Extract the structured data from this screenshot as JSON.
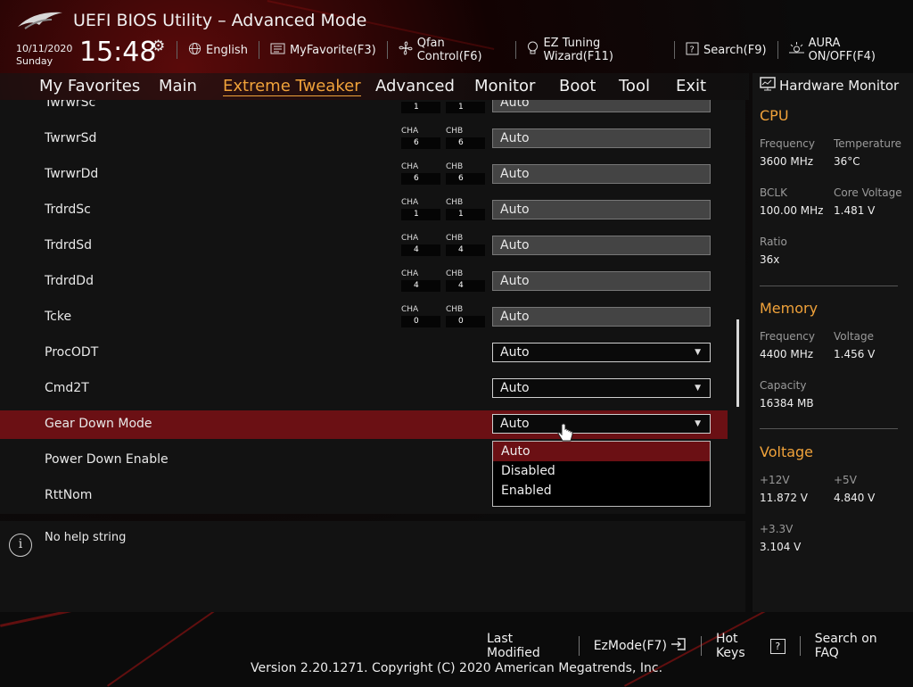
{
  "header": {
    "title": "UEFI BIOS Utility – Advanced Mode",
    "date": "10/11/2020",
    "day": "Sunday",
    "time": "15:48",
    "toolbar": [
      {
        "label": "English",
        "icon": "globe-icon"
      },
      {
        "label": "MyFavorite(F3)",
        "icon": "favorite-icon"
      },
      {
        "label": "Qfan Control(F6)",
        "icon": "fan-icon"
      },
      {
        "label": "EZ Tuning Wizard(F11)",
        "icon": "bulb-icon"
      },
      {
        "label": "Search(F9)",
        "icon": "help-search-icon"
      },
      {
        "label": "AURA ON/OFF(F4)",
        "icon": "aura-icon"
      }
    ]
  },
  "nav": {
    "tabs": [
      "My Favorites",
      "Main",
      "Extreme Tweaker",
      "Advanced",
      "Monitor",
      "Boot",
      "Tool",
      "Exit"
    ],
    "active": "Extreme Tweaker"
  },
  "settings": {
    "cha_label": "CHA",
    "chb_label": "CHB",
    "rows": [
      {
        "label": "TwrwrSc",
        "cha": "1",
        "chb": "1",
        "value": "Auto"
      },
      {
        "label": "TwrwrSd",
        "cha": "6",
        "chb": "6",
        "value": "Auto"
      },
      {
        "label": "TwrwrDd",
        "cha": "6",
        "chb": "6",
        "value": "Auto"
      },
      {
        "label": "TrdrdSc",
        "cha": "1",
        "chb": "1",
        "value": "Auto"
      },
      {
        "label": "TrdrdSd",
        "cha": "4",
        "chb": "4",
        "value": "Auto"
      },
      {
        "label": "TrdrdDd",
        "cha": "4",
        "chb": "4",
        "value": "Auto"
      },
      {
        "label": "Tcke",
        "cha": "0",
        "chb": "0",
        "value": "Auto"
      },
      {
        "label": "ProcODT",
        "value": "Auto"
      },
      {
        "label": "Cmd2T",
        "value": "Auto"
      },
      {
        "label": "Gear Down Mode",
        "value": "Auto"
      },
      {
        "label": "Power Down Enable"
      },
      {
        "label": "RttNom"
      }
    ],
    "dropdown_options": [
      "Auto",
      "Disabled",
      "Enabled"
    ],
    "dropdown_selected": "Auto"
  },
  "help": {
    "text": "No help string"
  },
  "hardware_monitor": {
    "title": "Hardware Monitor",
    "cpu": {
      "section": "CPU",
      "frequency_label": "Frequency",
      "frequency": "3600 MHz",
      "temperature_label": "Temperature",
      "temperature": "36°C",
      "bclk_label": "BCLK",
      "bclk": "100.00 MHz",
      "core_voltage_label": "Core Voltage",
      "core_voltage": "1.481 V",
      "ratio_label": "Ratio",
      "ratio": "36x"
    },
    "memory": {
      "section": "Memory",
      "frequency_label": "Frequency",
      "frequency": "4400 MHz",
      "voltage_label": "Voltage",
      "voltage": "1.456 V",
      "capacity_label": "Capacity",
      "capacity": "16384 MB"
    },
    "voltage": {
      "section": "Voltage",
      "v12_label": "+12V",
      "v12": "11.872 V",
      "v5_label": "+5V",
      "v5": "4.840 V",
      "v33_label": "+3.3V",
      "v33": "3.104 V"
    }
  },
  "footer": {
    "last_modified": "Last Modified",
    "ezmode": "EzMode(F7)",
    "hot_keys": "Hot Keys",
    "hot_keys_glyph": "?",
    "search_faq": "Search on FAQ",
    "copyright": "Version 2.20.1271. Copyright (C) 2020 American Megatrends, Inc."
  },
  "colors": {
    "accent": "#f0a23a",
    "selected_row": "#6b1014"
  }
}
